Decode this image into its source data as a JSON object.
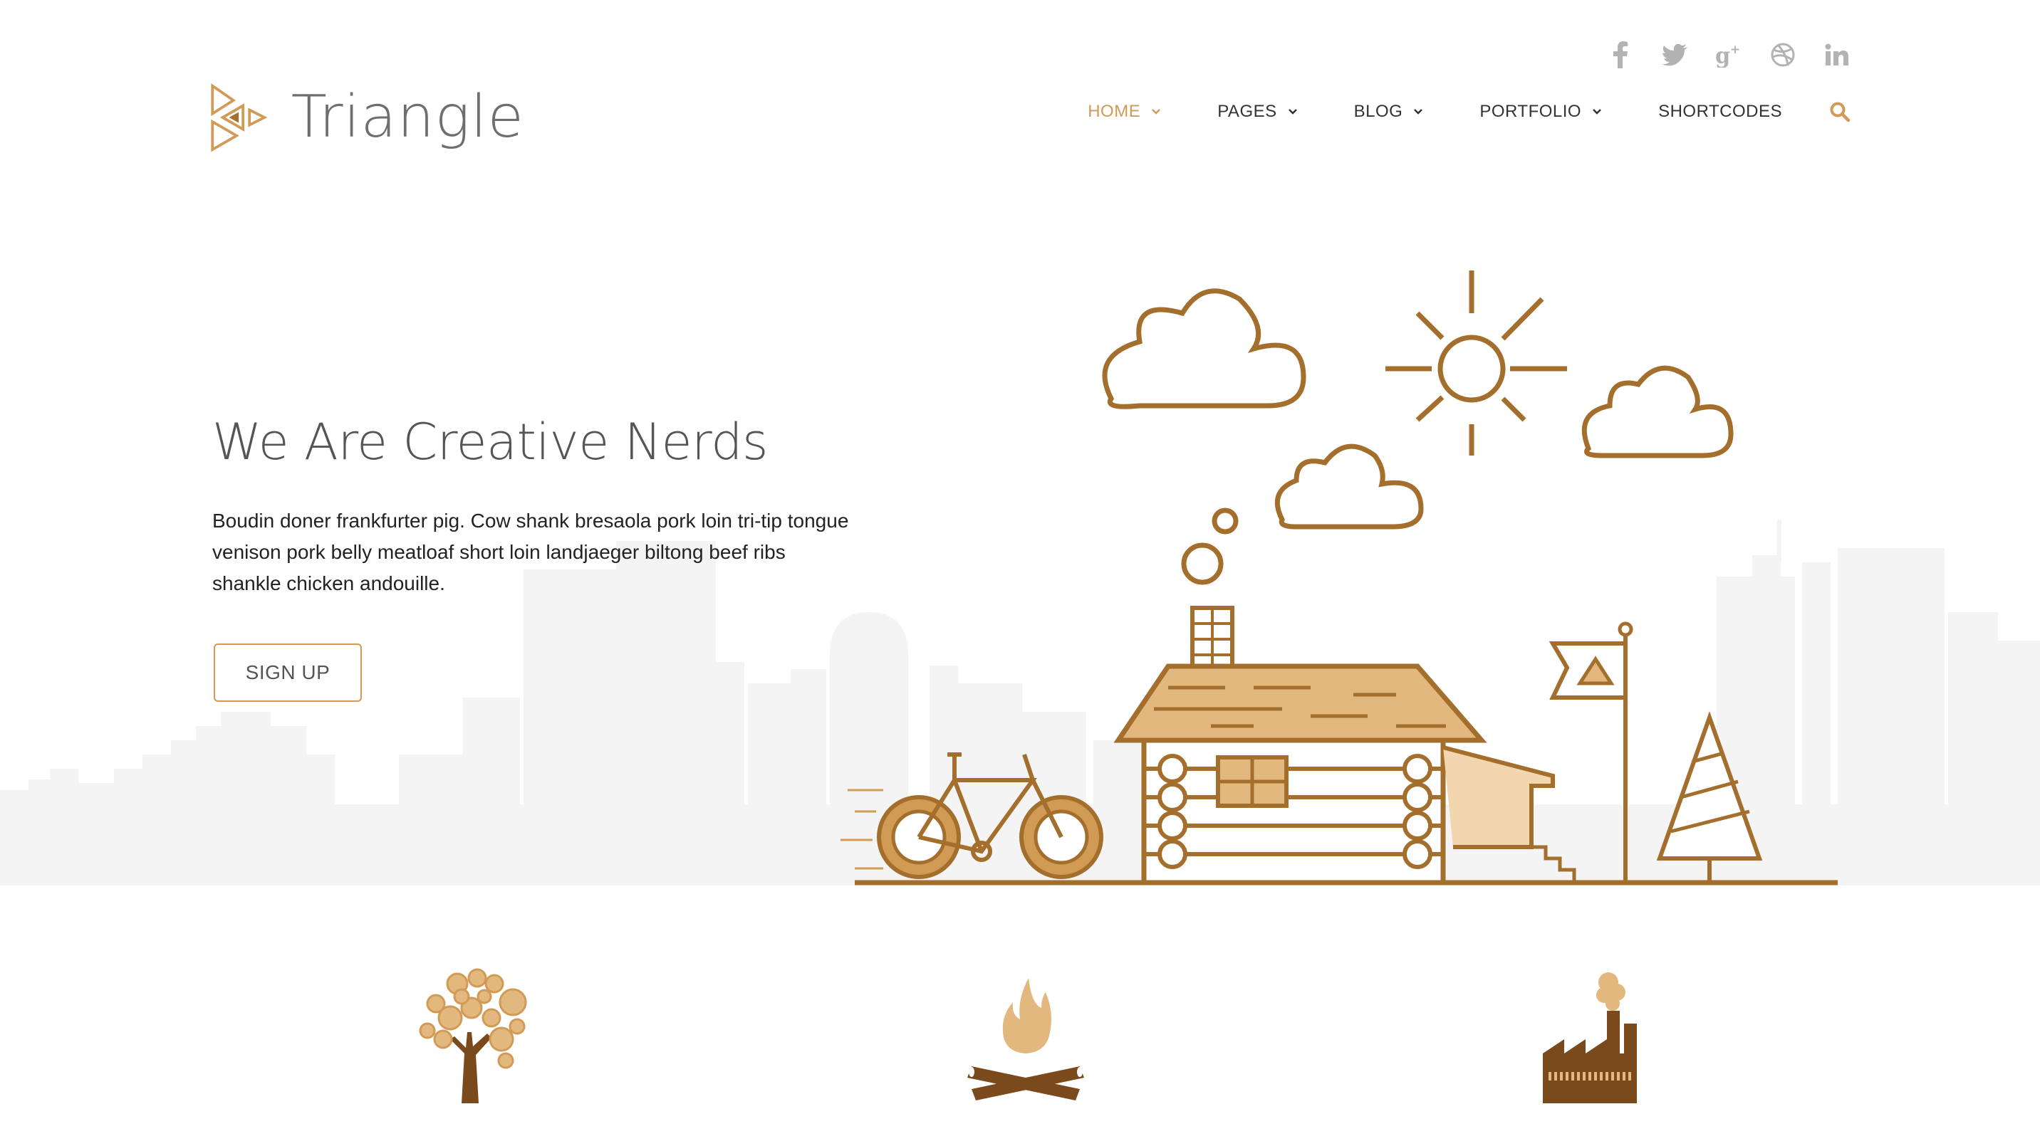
{
  "brand": {
    "name": "Triangle",
    "accent_color": "#d19a55",
    "dark_accent": "#a46e2c"
  },
  "social": [
    {
      "name": "facebook-icon",
      "glyph": "f"
    },
    {
      "name": "twitter-icon",
      "glyph": "t"
    },
    {
      "name": "google-plus-icon",
      "glyph": "g+"
    },
    {
      "name": "dribbble-icon",
      "glyph": "◎"
    },
    {
      "name": "linkedin-icon",
      "glyph": "in"
    }
  ],
  "nav": {
    "items": [
      {
        "label": "HOME",
        "has_dropdown": true,
        "active": true
      },
      {
        "label": "PAGES",
        "has_dropdown": true,
        "active": false
      },
      {
        "label": "BLOG",
        "has_dropdown": true,
        "active": false
      },
      {
        "label": "PORTFOLIO",
        "has_dropdown": true,
        "active": false
      },
      {
        "label": "SHORTCODES",
        "has_dropdown": false,
        "active": false
      }
    ],
    "search_icon": "search-icon"
  },
  "hero": {
    "title": "We Are Creative Nerds",
    "body": "Boudin doner frankfurter pig. Cow shank bresaola pork loin tri-tip tongue venison pork belly meatloaf short loin landjaeger biltong beef ribs shankle chicken andouille.",
    "cta_label": "SIGN UP",
    "background_color": "#f4f4f4"
  },
  "features": [
    {
      "icon": "tree-icon"
    },
    {
      "icon": "campfire-icon"
    },
    {
      "icon": "factory-icon"
    }
  ]
}
